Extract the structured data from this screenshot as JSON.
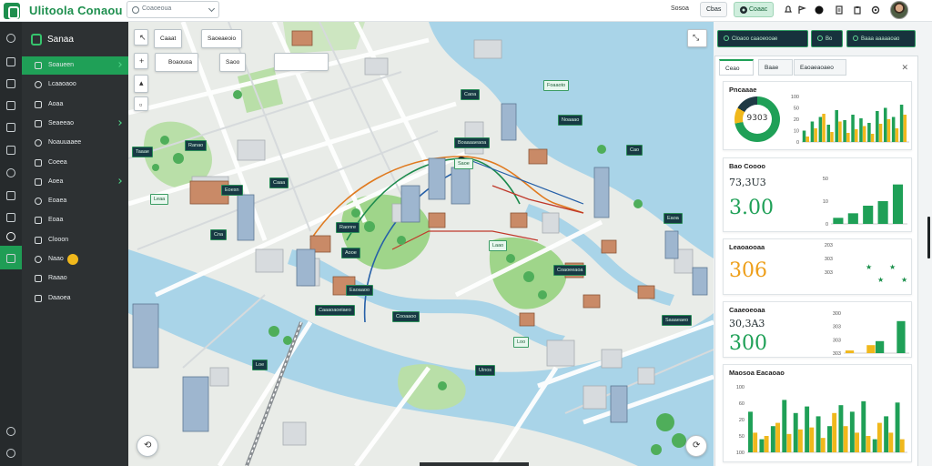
{
  "app": {
    "title": "Ulitoola Conaou",
    "search_placeholder": "Coaoeoua"
  },
  "topbar": {
    "link_label": "Sosoa",
    "btn_label": "Cbas",
    "btn_green_label": "Coaac",
    "icon_names": [
      "notification-icon",
      "avatar-moon-icon",
      "document-icon",
      "clipboard-icon",
      "settings-icon"
    ]
  },
  "rail": {
    "icons": [
      "power-icon",
      "layers-icon",
      "inbox-icon",
      "calendar-icon",
      "table-icon",
      "chart-icon",
      "folder-icon",
      "files-icon",
      "monitor-icon",
      "map-pin-icon",
      "card-icon",
      "help-icon",
      "settings-icon"
    ]
  },
  "sidebar": {
    "header": "Sanaa",
    "items": [
      {
        "label": "Soaueen",
        "icon": "grid-icon",
        "active": true,
        "arrow": true
      },
      {
        "label": "Lcaaoaoo",
        "icon": "layers-icon"
      },
      {
        "label": "Aoaa",
        "icon": "home-icon"
      },
      {
        "label": "Seaeeao",
        "icon": "chart-icon",
        "arrow": true
      },
      {
        "label": "Noauuaaee",
        "icon": "list-icon"
      },
      {
        "label": "Coeea",
        "icon": "clock-icon"
      },
      {
        "label": "Aoea",
        "icon": "folder-icon",
        "arrow": true
      },
      {
        "label": "Eoaea",
        "icon": "file-icon"
      },
      {
        "label": "Eoaa",
        "icon": "user-icon"
      },
      {
        "label": "Clooon",
        "icon": "map-icon"
      },
      {
        "label": "Naao",
        "icon": "tag-icon",
        "badge": true
      },
      {
        "label": "Raaao",
        "icon": "doc-icon"
      },
      {
        "label": "Daaoea",
        "icon": "check-icon"
      }
    ]
  },
  "map": {
    "chips": [
      "Caaat",
      "Saoeaeoio",
      "Boaouoa",
      "Saoo"
    ],
    "labels": [
      "Taaae",
      "Ranao",
      "Leaa",
      "Eoesn",
      "Caaa",
      "Boaaaaeaoa",
      "Caoa",
      "Foaaoto",
      "Noaaao",
      "Cao",
      "Raonre",
      "Aooe",
      "Laao",
      "Cna",
      "Eaoaaoo",
      "Caaaoaoeiaeo",
      "Cooaaoo",
      "Loo",
      "Uinos",
      "Coaoeeaoa",
      "Eaoa",
      "Saaaeaeo",
      "Saoe",
      "Loe"
    ],
    "map_controls": [
      "cursor-icon",
      "pan-icon",
      "hand-icon",
      "locate-icon",
      "compass-icon"
    ]
  },
  "right_panel": {
    "top_buttons": [
      "Cloaoo caaoeooae",
      "Bo",
      "Baaa aaaaaoao"
    ],
    "tabs": [
      "Ceao",
      "Baae",
      "Eaoaeaoaeo"
    ],
    "cards": [
      {
        "title": "Pncaaae",
        "donut_label": "9303",
        "donut_value": 0.72,
        "axis": [
          "100",
          "50",
          "20",
          "10",
          "0"
        ],
        "chart_data": {
          "type": "bar",
          "title": "Pncaaae",
          "ylim": [
            0,
            100
          ],
          "series": [
            {
              "color": "#1fa057",
              "values": [
                25,
                45,
                55,
                38,
                70,
                48,
                60,
                52,
                42,
                68,
                75,
                55,
                82
              ]
            },
            {
              "color": "#f0b81c",
              "values": [
                12,
                30,
                62,
                22,
                45,
                20,
                28,
                35,
                18,
                40,
                50,
                30,
                60
              ]
            }
          ]
        }
      },
      {
        "title": "Bao Coooo",
        "subnum": "73,3U3",
        "bignum": "3.00",
        "axis": [
          "50",
          "10",
          "0"
        ],
        "chart_data": {
          "type": "bar",
          "ylim": [
            0,
            60
          ],
          "series": [
            {
              "color": "#1fa057",
              "values": [
                8,
                14,
                24,
                30,
                52
              ]
            }
          ]
        }
      },
      {
        "title": "Leaoaooaa",
        "bignum": "306",
        "axis": [
          "203",
          "303",
          "303"
        ],
        "stars": 4
      },
      {
        "title": "Caaeoeoaa",
        "subnum": "30,3A3",
        "bignum": "300",
        "axis": [
          "300",
          "303",
          "303",
          "303"
        ],
        "chart_data": {
          "type": "bar",
          "ylim": [
            0,
            60
          ],
          "series": [
            {
              "color": "#f0b81c",
              "values": [
                4,
                12,
                0
              ]
            },
            {
              "color": "#1fa057",
              "values": [
                0,
                18,
                48
              ]
            }
          ]
        }
      },
      {
        "title": "Maosoa Eacaoao",
        "axis": [
          "100",
          "60",
          "20",
          "50",
          "100"
        ],
        "chart_data": {
          "type": "bar",
          "ylim": [
            0,
            100
          ],
          "series": [
            {
              "color": "#1fa057",
              "values": [
                62,
                20,
                40,
                80,
                60,
                70,
                55,
                40,
                72,
                62,
                78,
                20,
                55,
                76
              ]
            },
            {
              "color": "#f0b81c",
              "values": [
                30,
                25,
                45,
                28,
                35,
                38,
                22,
                60,
                40,
                30,
                25,
                45,
                30,
                20
              ]
            }
          ]
        }
      }
    ]
  }
}
